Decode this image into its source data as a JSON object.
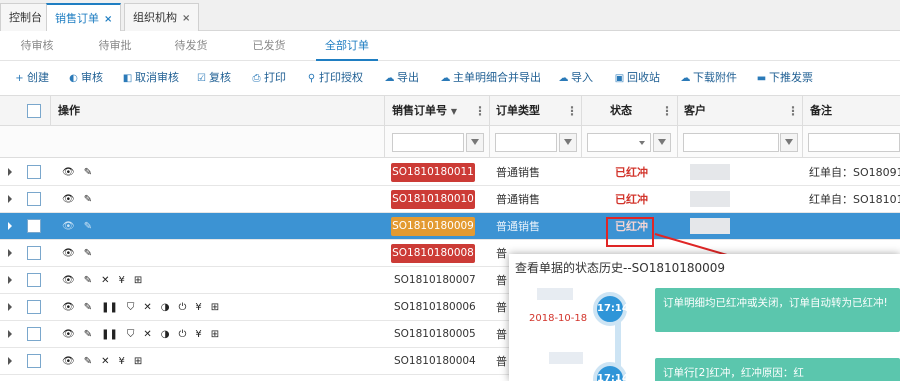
{
  "tabs": [
    {
      "label": "控制台"
    },
    {
      "label": "销售订单",
      "close": "×"
    },
    {
      "label": "组织机构",
      "close": "×"
    }
  ],
  "subtabs": [
    "待审核",
    "待审批",
    "待发货",
    "已发货",
    "全部订单"
  ],
  "toolbar": [
    {
      "label": "创建",
      "icon": "+"
    },
    {
      "label": "审核",
      "icon": "◐"
    },
    {
      "label": "取消审核",
      "icon": "◧"
    },
    {
      "label": "复核",
      "icon": "☑"
    },
    {
      "label": "打印",
      "icon": "⎙"
    },
    {
      "label": "打印授权",
      "icon": "⚲"
    },
    {
      "label": "导出",
      "icon": "☁"
    },
    {
      "label": "主单明细合并导出",
      "icon": "☁"
    },
    {
      "label": "导入",
      "icon": "☁"
    },
    {
      "label": "回收站",
      "icon": "▣"
    },
    {
      "label": "下载附件",
      "icon": "☁"
    },
    {
      "label": "下推发票",
      "icon": "▬"
    }
  ],
  "columns": {
    "ops": "操作",
    "order_no": "销售订单号",
    "order_type": "订单类型",
    "status": "状态",
    "customer": "客户",
    "remark": "备注"
  },
  "rows": [
    {
      "ops": [
        "👁",
        "✎"
      ],
      "order_no": "SO1810180011",
      "type": "普通销售",
      "status": "已红冲",
      "remark": "红单自：SO180919"
    },
    {
      "ops": [
        "👁",
        "✎"
      ],
      "order_no": "SO1810180010",
      "type": "普通销售",
      "status": "已红冲",
      "remark": "红单自：SO181018"
    },
    {
      "ops": [
        "👁",
        "✎"
      ],
      "order_no": "SO1810180009",
      "type": "普通销售",
      "status": "已红冲",
      "remark": ""
    },
    {
      "ops": [
        "👁",
        "✎"
      ],
      "order_no": "SO1810180008",
      "type": "普",
      "status": "",
      "remark": ""
    },
    {
      "ops": [
        "👁",
        "✎",
        "✕",
        "¥",
        "⊞"
      ],
      "order_no": "SO1810180007",
      "type": "普",
      "status": "",
      "remark": ""
    },
    {
      "ops": [
        "👁",
        "✎",
        "❚❚",
        "⛉",
        "✕",
        "◑",
        "⏻",
        "¥",
        "⊞"
      ],
      "order_no": "SO1810180006",
      "type": "普",
      "status": "",
      "remark": ""
    },
    {
      "ops": [
        "👁",
        "✎",
        "❚❚",
        "⛉",
        "✕",
        "◑",
        "⏻",
        "¥",
        "⊞"
      ],
      "order_no": "SO1810180005",
      "type": "普",
      "status": "",
      "remark": ""
    },
    {
      "ops": [
        "👁",
        "✎",
        "✕",
        "¥",
        "⊞"
      ],
      "order_no": "SO1810180004",
      "type": "普",
      "status": "",
      "remark": ""
    }
  ],
  "popup": {
    "title": "查看单据的状态历史--SO1810180009",
    "entries": [
      {
        "time": "17:14",
        "date": "2018-10-18",
        "text": "订单明细均已红冲或关闭，订单自动转为已红冲!"
      },
      {
        "time": "17:14",
        "date": "",
        "text": "订单行[2]红冲，红冲原因：红"
      }
    ]
  },
  "colors": {
    "accent": "#1f7ec2",
    "selected_row": "#3c93d3",
    "danger": "#cc3b36",
    "warning": "#e39a31",
    "timeline_card": "#5bc6ad"
  }
}
